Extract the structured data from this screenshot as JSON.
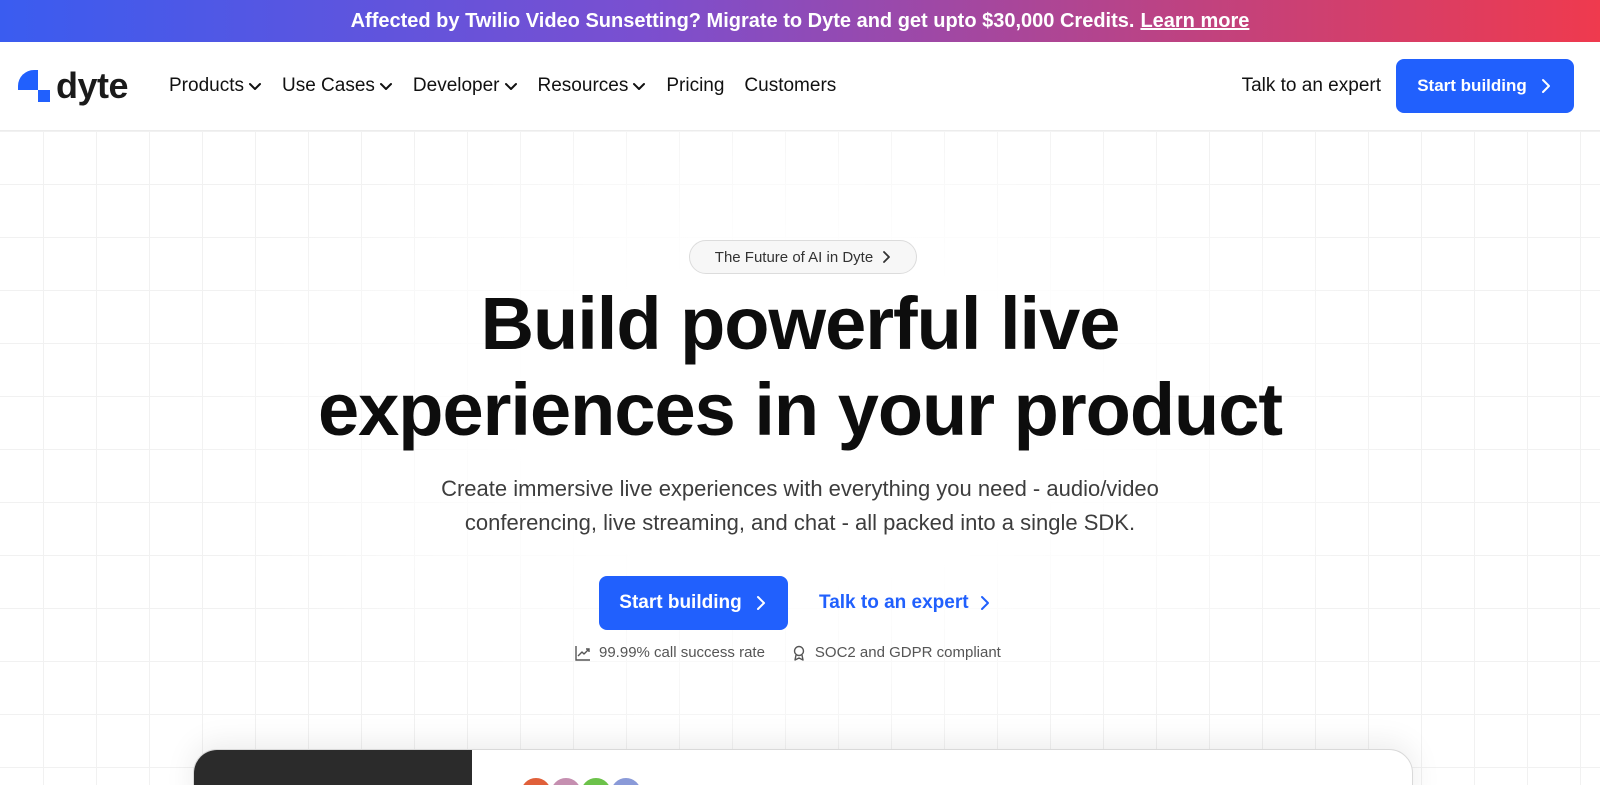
{
  "banner": {
    "text": "Affected by Twilio Video Sunsetting? Migrate to Dyte and get upto $30,000 Credits.",
    "link": "Learn more"
  },
  "nav": {
    "logo_text": "dyte",
    "items": [
      {
        "label": "Products",
        "dropdown": true
      },
      {
        "label": "Use Cases",
        "dropdown": true
      },
      {
        "label": "Developer",
        "dropdown": true
      },
      {
        "label": "Resources",
        "dropdown": true
      },
      {
        "label": "Pricing",
        "dropdown": false
      },
      {
        "label": "Customers",
        "dropdown": false
      }
    ],
    "talk_label": "Talk to an expert",
    "cta_label": "Start building"
  },
  "hero": {
    "pill": "The Future of AI in Dyte",
    "headline_line1": "Build powerful live",
    "headline_line2": "experiences in your product",
    "subtext": "Create immersive live experiences with everything you need - audio/video conferencing, live streaming, and chat - all packed into a single SDK.",
    "cta_label": "Start building",
    "talk_label": "Talk to an expert",
    "stats": [
      {
        "icon": "trending-up-icon",
        "text": "99.99% call success rate"
      },
      {
        "icon": "award-icon",
        "text": "SOC2 and GDPR compliant"
      }
    ]
  },
  "colors": {
    "accent": "#2160fd",
    "banner_start": "#3a5cf0",
    "banner_end": "#ef3a4e",
    "avatars": [
      "#e0603a",
      "#c58fb0",
      "#6cc24a",
      "#8a9ad8"
    ]
  }
}
